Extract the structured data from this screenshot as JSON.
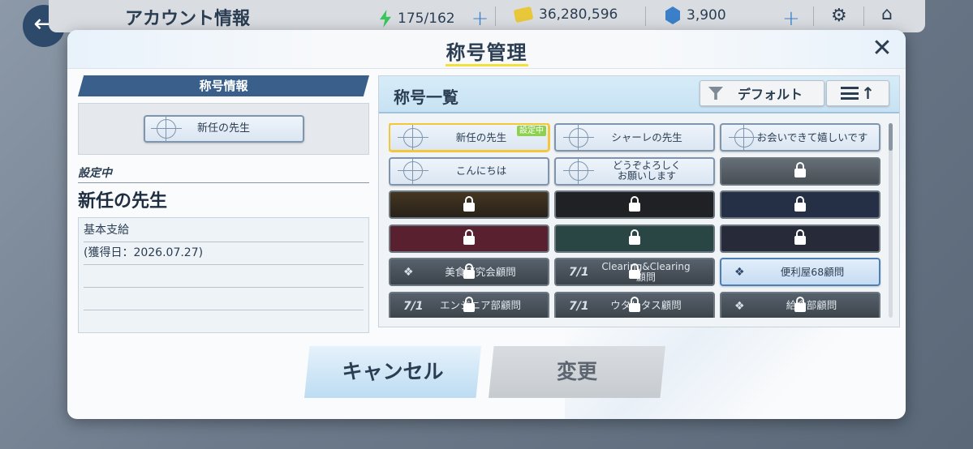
{
  "topbar": {
    "title": "アカウント情報",
    "ap": "175/162",
    "credits": "36,280,596",
    "gems": "3,900"
  },
  "modal": {
    "title": "称号管理",
    "left": {
      "section_label": "称号情報",
      "preview_title": "新任の先生",
      "status_label": "設定中",
      "current_title": "新任の先生",
      "info_lines": [
        "基本支給",
        "(獲得日：2026.07.27)",
        "",
        ""
      ]
    },
    "right": {
      "list_title": "称号一覧",
      "sort_label": "デフォルト",
      "badge_label": "設定中",
      "titles": [
        {
          "text": "新任の先生",
          "state": "selected"
        },
        {
          "text": "シャーレの先生",
          "state": "unlocked"
        },
        {
          "text": "お会いできて嬉しいです",
          "state": "unlocked"
        },
        {
          "text": "こんにちは",
          "state": "unlocked"
        },
        {
          "text": "どうぞよろしく\nお願いします",
          "state": "unlocked"
        },
        {
          "text": "",
          "state": "locked"
        },
        {
          "text": "",
          "state": "locked"
        },
        {
          "text": "",
          "state": "locked"
        },
        {
          "text": "",
          "state": "locked"
        },
        {
          "text": "",
          "state": "locked"
        },
        {
          "text": "",
          "state": "locked"
        },
        {
          "text": "",
          "state": "locked"
        },
        {
          "text": "美食研究会顧問",
          "state": "locked"
        },
        {
          "text": "Clearing&Clearing\n顧問",
          "state": "locked"
        },
        {
          "text": "便利屋68顧問",
          "state": "unlocked"
        },
        {
          "text": "エンジニア部顧問",
          "state": "locked"
        },
        {
          "text": "ウタリタス顧問",
          "state": "locked"
        },
        {
          "text": "給食部顧問",
          "state": "locked"
        }
      ]
    },
    "buttons": {
      "cancel": "キャンセル",
      "change": "変更"
    }
  },
  "colors": {
    "accent_yellow": "#f1e13a",
    "banner_blue": "#3a5f8a",
    "text_dark": "#2b3d52",
    "badge_green": "#8fd14f"
  }
}
